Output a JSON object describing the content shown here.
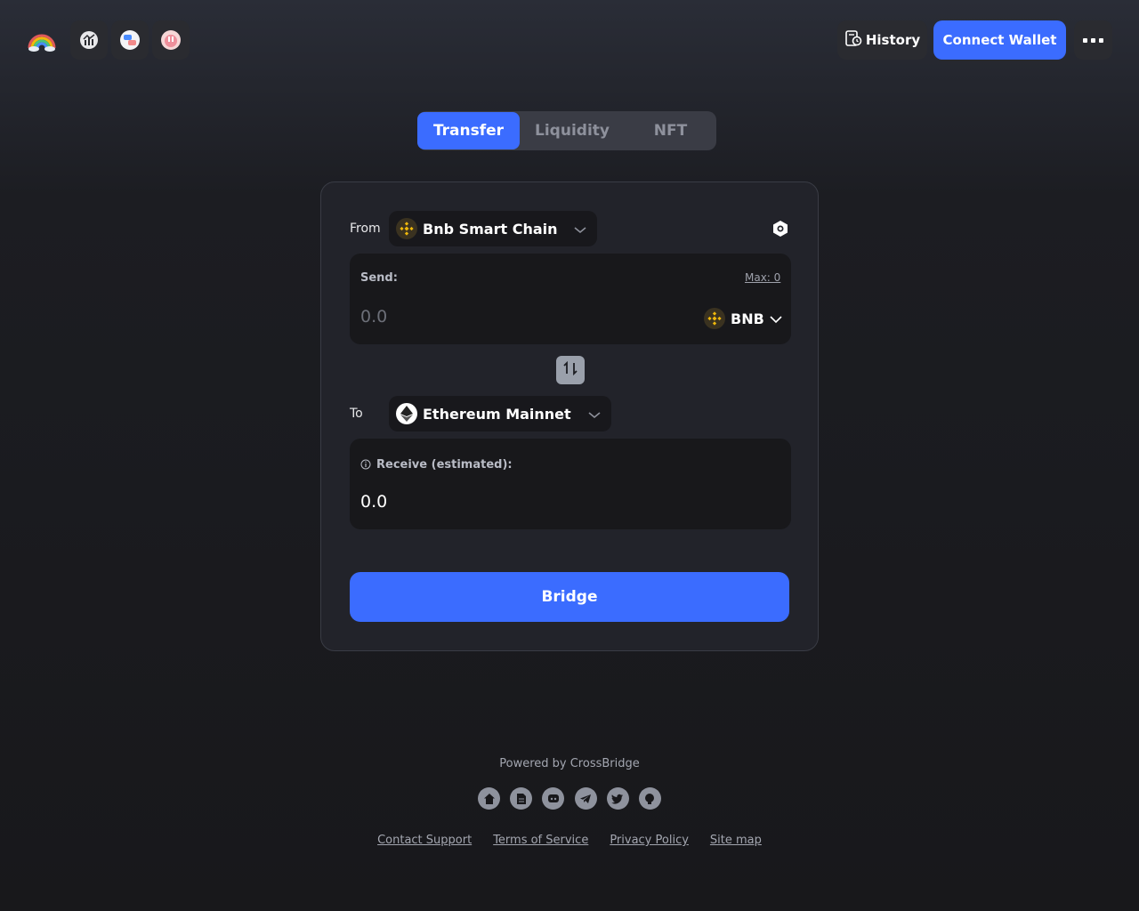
{
  "header": {
    "history_label": "History",
    "connect_label": "Connect Wallet"
  },
  "tabs": [
    {
      "label": "Transfer",
      "active": true
    },
    {
      "label": "Liquidity",
      "active": false
    },
    {
      "label": "NFT",
      "active": false
    }
  ],
  "from": {
    "label": "From",
    "chain": "Bnb Smart Chain",
    "chain_icon": "bnb-icon"
  },
  "send": {
    "label": "Send:",
    "max_label": "Max: 0",
    "placeholder": "0.0",
    "token": "BNB",
    "token_icon": "bnb-icon"
  },
  "to": {
    "label": "To",
    "chain": "Ethereum Mainnet",
    "chain_icon": "eth-icon"
  },
  "receive": {
    "label": "Receive (estimated):",
    "value": "0.0"
  },
  "bridge_label": "Bridge",
  "footer": {
    "powered_by": "Powered by CrossBridge",
    "socials": [
      "home-icon",
      "document-icon",
      "discord-icon",
      "telegram-icon",
      "twitter-icon",
      "github-icon"
    ],
    "links": [
      "Contact Support",
      "Terms of Service",
      "Privacy Policy",
      "Site map"
    ]
  },
  "colors": {
    "accent": "#3b6cff",
    "card": "#22232a",
    "panel": "#18181b",
    "bnb": "#f0b90b"
  }
}
